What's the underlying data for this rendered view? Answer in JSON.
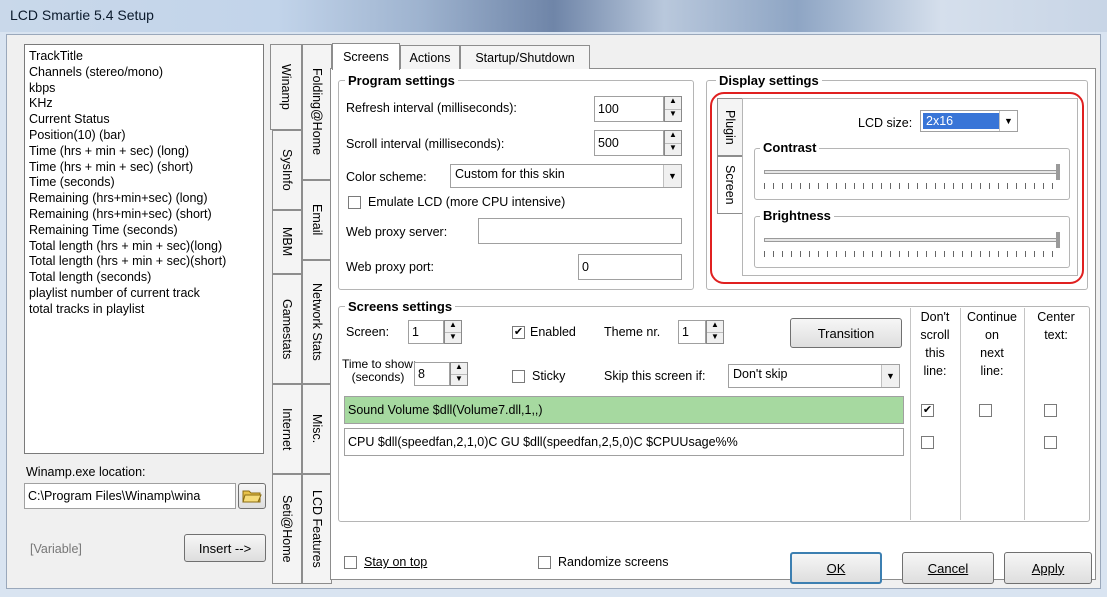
{
  "window": {
    "title": "LCD Smartie 5.4 Setup"
  },
  "plugin_list": {
    "items": [
      "TrackTitle",
      "Channels (stereo/mono)",
      "kbps",
      "KHz",
      "Current Status",
      "Position(10) (bar)",
      "Time (hrs + min + sec) (long)",
      "Time (hrs + min + sec) (short)",
      "Time (seconds)",
      "Remaining (hrs+min+sec) (long)",
      "Remaining (hrs+min+sec) (short)",
      "Remaining Time (seconds)",
      "Total length (hrs + min + sec)(long)",
      "Total length (hrs + min + sec)(short)",
      "Total length (seconds)",
      "playlist number of current track",
      "total tracks in playlist"
    ],
    "location_label": "Winamp.exe location:",
    "location_value": "C:\\Program Files\\Winamp\\wina",
    "variable_label": "[Variable]",
    "insert_label": "Insert -->"
  },
  "side_tabs": {
    "col1": [
      "Winamp",
      "SysInfo",
      "MBM",
      "Gamestats",
      "Internet",
      "Seti@Home"
    ],
    "col2": [
      "Folding@Home",
      "Email",
      "Network Stats",
      "Misc.",
      "LCD Features"
    ]
  },
  "tabs": [
    "Screens",
    "Actions",
    "Startup/Shutdown"
  ],
  "program_settings": {
    "title": "Program settings",
    "refresh_label": "Refresh interval (milliseconds):",
    "refresh_value": "100",
    "scroll_label": "Scroll interval (milliseconds):",
    "scroll_value": "500",
    "color_label": "Color scheme:",
    "color_value": "Custom for this skin",
    "emulate_label": "Emulate LCD  (more CPU intensive)",
    "proxy_server_label": "Web proxy server:",
    "proxy_server_value": "",
    "proxy_port_label": "Web proxy port:",
    "proxy_port_value": "0"
  },
  "display_settings": {
    "title": "Display settings",
    "vtabs": [
      "Plugin",
      "Screen"
    ],
    "lcd_size_label": "LCD size:",
    "lcd_size_value": "2x16",
    "contrast_label": "Contrast",
    "brightness_label": "Brightness",
    "contrast_level": 1.0,
    "brightness_level": 1.0,
    "highlight_color": "#e02020"
  },
  "screens_settings": {
    "title": "Screens settings",
    "screen_label": "Screen:",
    "screen_value": "1",
    "enabled_label": "Enabled",
    "theme_label": "Theme nr.",
    "theme_value": "1",
    "transition_label": "Transition",
    "time_label_1": "Time to show:",
    "time_label_2": "(seconds)",
    "time_value": "8",
    "sticky_label": "Sticky",
    "skip_label": "Skip this screen if:",
    "skip_value": "Don't skip",
    "line1": "Sound Volume $dll(Volume7.dll,1,,)",
    "line2": "CPU $dll(speedfan,2,1,0)C GU $dll(speedfan,2,5,0)C  $CPUUsage%%",
    "line1_bg": "#a6d9a0",
    "col_noscroll": [
      "Don't",
      "scroll",
      "this",
      "line:"
    ],
    "col_continue": [
      "Continue",
      "on",
      "next",
      "line:"
    ],
    "col_center": [
      "Center",
      "text:"
    ]
  },
  "bottom": {
    "stay_on_top": "Stay on top",
    "randomize": "Randomize screens",
    "ok": "OK",
    "cancel": "Cancel",
    "apply": "Apply"
  }
}
